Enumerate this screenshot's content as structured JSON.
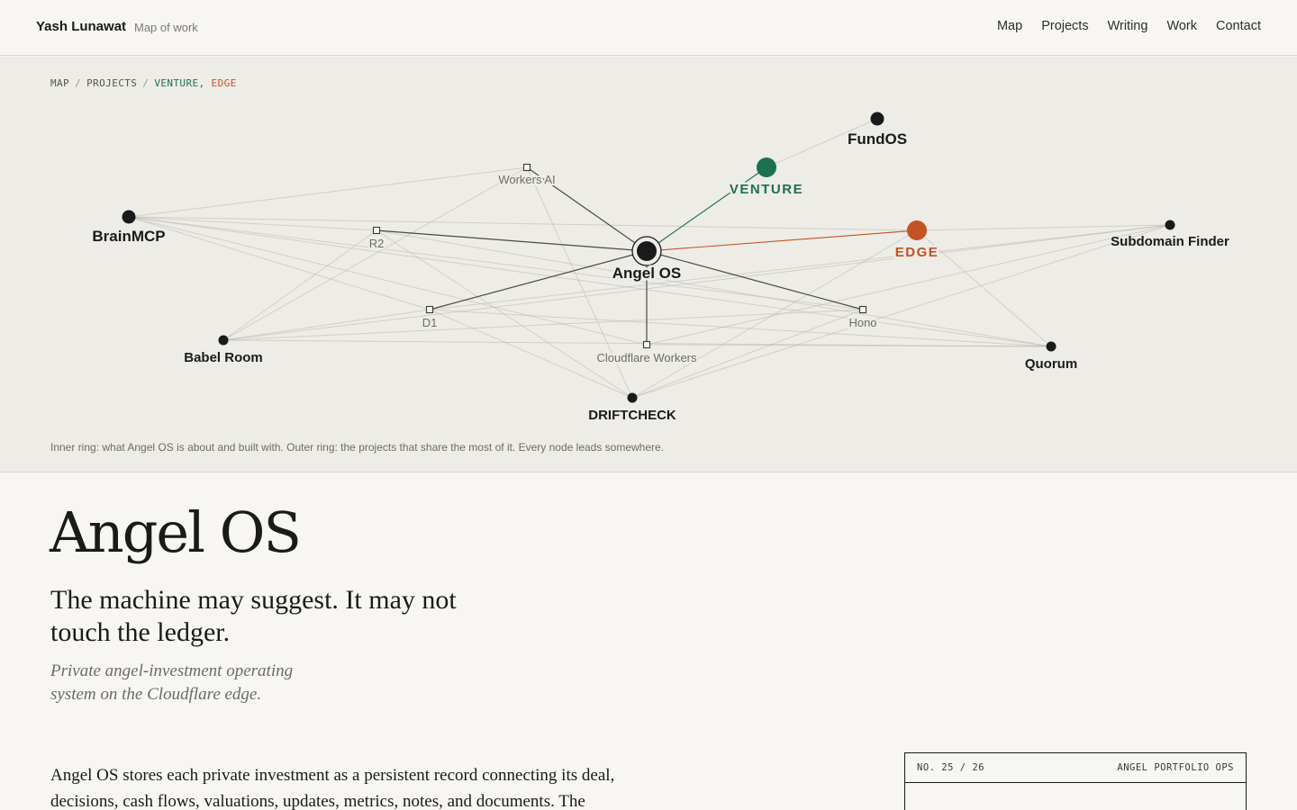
{
  "header": {
    "brand": "Yash Lunawat",
    "tagline": "Map of work",
    "nav": [
      "Map",
      "Projects",
      "Writing",
      "Work",
      "Contact"
    ]
  },
  "breadcrumb": {
    "items": [
      "MAP",
      "PROJECTS"
    ],
    "active": [
      "VENTURE",
      "EDGE"
    ],
    "separator": "/"
  },
  "graph": {
    "center": "Angel OS",
    "inner_ring": [
      "Workers AI",
      "R2",
      "D1",
      "Cloudflare Workers",
      "Hono"
    ],
    "highlighted": [
      {
        "label": "VENTURE",
        "color": "#1d7050"
      },
      {
        "label": "EDGE",
        "color": "#c35224"
      }
    ],
    "outer_ring": [
      "FundOS",
      "BrainMCP",
      "Subdomain Finder",
      "Babel Room",
      "Quorum",
      "DRIFTCHECK"
    ]
  },
  "map_caption": "Inner ring: what Angel OS is about and built with. Outer ring: the projects that share the most of it. Every node leads somewhere.",
  "project": {
    "title": "Angel OS",
    "subtitle": "The machine may suggest. It may not touch the ledger.",
    "lede": "Private angel-investment operating system on the Cloudflare edge.",
    "body": "Angel OS stores each private investment as a persistent record connecting its deal, decisions, cash flows, valuations, updates, metrics, notes, and documents. The"
  },
  "card": {
    "number": "NO. 25 / 26",
    "category": "ANGEL PORTFOLIO OPS"
  },
  "colors": {
    "background": "#f7f6f2",
    "map_background": "#edece7",
    "venture": "#1d7050",
    "edge": "#c35224",
    "ink": "#1a1a1a"
  }
}
